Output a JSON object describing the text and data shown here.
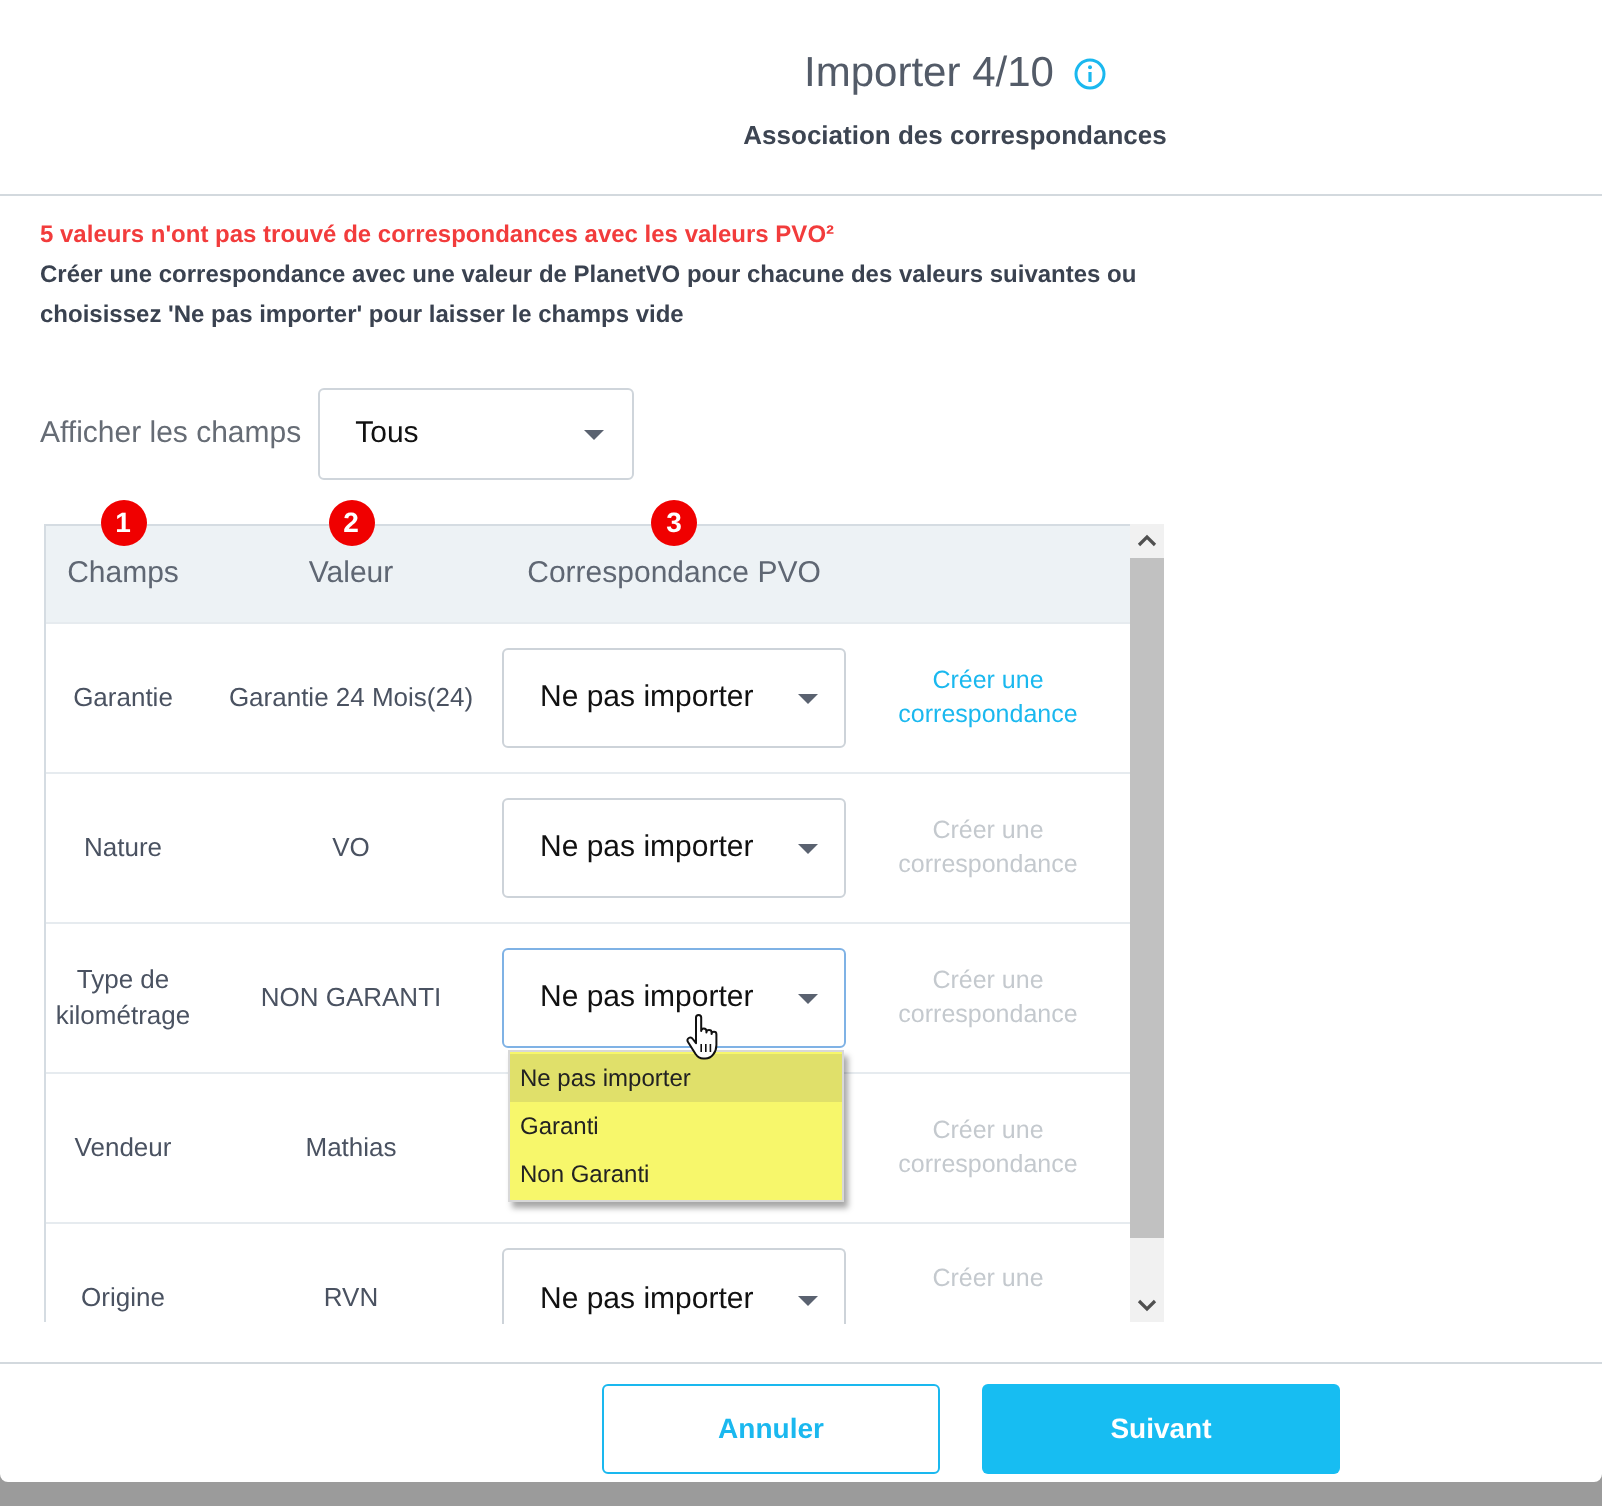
{
  "dialog": {
    "title": "Importer 4/10",
    "subtitle": "Association des correspondances"
  },
  "notice": {
    "warning": "5 valeurs n'ont pas trouvé de correspondances avec les valeurs PVO²",
    "instruction": "Créer une correspondance avec une valeur de PlanetVO pour chacune des valeurs suivantes ou choisissez 'Ne pas importer' pour laisser le champs vide"
  },
  "filter": {
    "label": "Afficher les champs",
    "value": "Tous"
  },
  "table": {
    "columns": [
      {
        "label": "Champs",
        "marker": "1"
      },
      {
        "label": "Valeur",
        "marker": "2"
      },
      {
        "label": "Correspondance PVO",
        "marker": "3"
      }
    ],
    "rows": [
      {
        "field": "Garantie",
        "value": "Garantie 24 Mois(24)",
        "mapping": "Ne pas importer",
        "focused": false,
        "link": {
          "label": "Créer une correspondance",
          "disabled": false
        }
      },
      {
        "field": "Nature",
        "value": "VO",
        "mapping": "Ne pas importer",
        "focused": false,
        "link": {
          "label": "Créer une correspondance",
          "disabled": true
        }
      },
      {
        "field": "Type de kilométrage",
        "value": "NON GARANTI",
        "mapping": "Ne pas importer",
        "focused": true,
        "options": [
          {
            "label": "Ne pas importer",
            "selected": true
          },
          {
            "label": "Garanti",
            "selected": false
          },
          {
            "label": "Non Garanti",
            "selected": false
          }
        ],
        "link": {
          "label": "Créer une correspondance",
          "disabled": true
        }
      },
      {
        "field": "Vendeur",
        "value": "Mathias",
        "link": {
          "label": "Créer une correspondance",
          "disabled": true
        }
      },
      {
        "field": "Origine",
        "value": "RVN",
        "mapping": "Ne pas importer",
        "focused": false,
        "link": {
          "label": "Créer une",
          "disabled": true
        }
      }
    ]
  },
  "buttons": [
    {
      "label": "Annuler",
      "kind": "outline"
    },
    {
      "label": "Suivant",
      "kind": "primary"
    }
  ]
}
